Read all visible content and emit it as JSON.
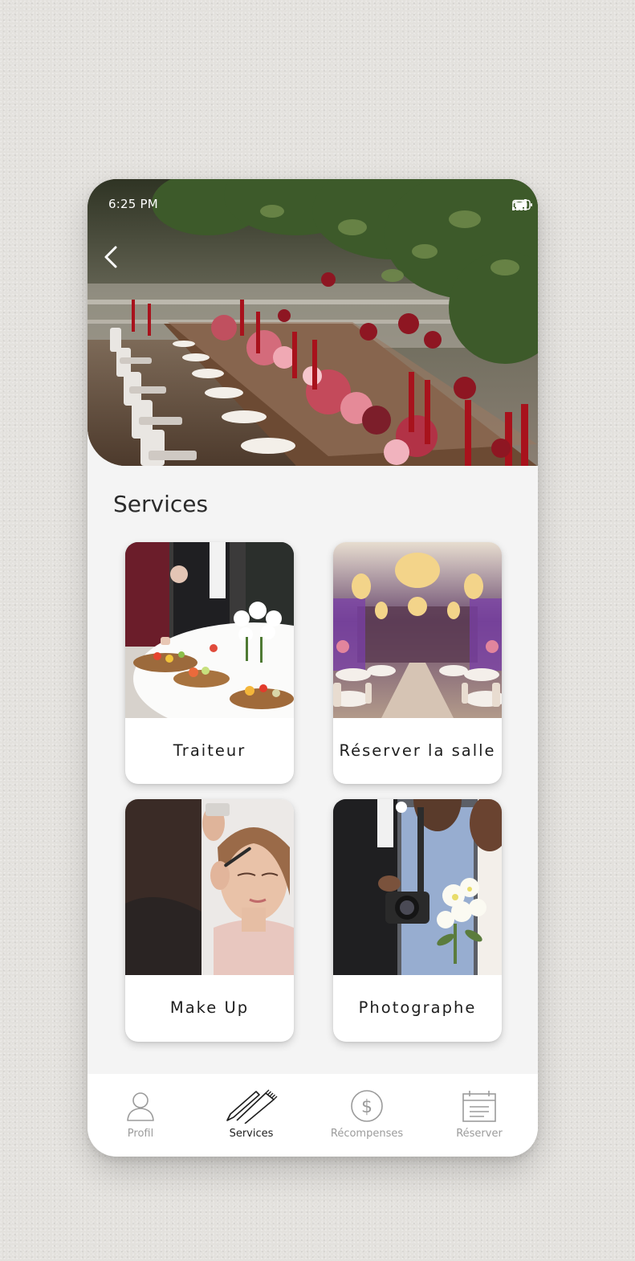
{
  "status_bar": {
    "time": "6:25 PM",
    "icons": [
      "signal-icon",
      "wifi-icon",
      "battery-icon"
    ]
  },
  "header": {
    "back_icon": "chevron-left-icon"
  },
  "page": {
    "title": "Services"
  },
  "services": [
    {
      "label": "Traiteur",
      "image": "catering-photo"
    },
    {
      "label": "Réserver la salle",
      "image": "banquet-hall-photo"
    },
    {
      "label": "Make Up",
      "image": "makeup-photo"
    },
    {
      "label": "Photographe",
      "image": "photographer-photo"
    }
  ],
  "bottom_nav": [
    {
      "label": "Profil",
      "icon": "user-icon",
      "active": false
    },
    {
      "label": "Services",
      "icon": "comb-pen-icon",
      "active": true
    },
    {
      "label": "Récompenses",
      "icon": "dollar-coin-icon",
      "active": false
    },
    {
      "label": "Réserver",
      "icon": "calendar-icon",
      "active": false
    }
  ],
  "colors": {
    "background": "#e3e1dd",
    "screen": "#f4f4f4",
    "text": "#1e1e1e",
    "nav_inactive": "#9b9b9b",
    "wine_red": "#a8121c"
  }
}
